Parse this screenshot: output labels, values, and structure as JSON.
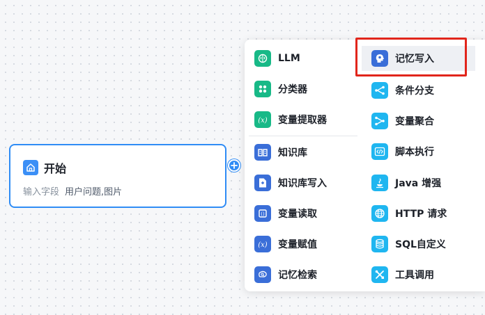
{
  "start_node": {
    "title": "开始",
    "field_label": "输入字段",
    "field_value": "用户问题,图片"
  },
  "menu": {
    "left": [
      {
        "label": "LLM",
        "icon": "brain-icon",
        "color": "#18b987"
      },
      {
        "label": "分类器",
        "icon": "grid-dots-icon",
        "color": "#18b987"
      },
      {
        "label": "变量提取器",
        "icon": "variable-x-icon",
        "color": "#18b987"
      },
      {
        "label": "知识库",
        "icon": "book-icon",
        "color": "#3a6ed8"
      },
      {
        "label": "知识库写入",
        "icon": "doc-add-icon",
        "color": "#3a6ed8"
      },
      {
        "label": "变量读取",
        "icon": "variable-read-icon",
        "color": "#3a6ed8"
      },
      {
        "label": "变量赋值",
        "icon": "variable-x-icon",
        "color": "#3a6ed8"
      },
      {
        "label": "记忆检索",
        "icon": "brain-search-icon",
        "color": "#3a6ed8"
      }
    ],
    "right": [
      {
        "label": "记忆写入",
        "icon": "head-memory-icon",
        "color": "#3a6ed8"
      },
      {
        "label": "条件分支",
        "icon": "branch-icon",
        "color": "#1fb6f0"
      },
      {
        "label": "变量聚合",
        "icon": "merge-icon",
        "color": "#1fb6f0"
      },
      {
        "label": "脚本执行",
        "icon": "code-icon",
        "color": "#1fb6f0"
      },
      {
        "label": "Java 增强",
        "icon": "java-icon",
        "color": "#1fb6f0"
      },
      {
        "label": "HTTP 请求",
        "icon": "globe-icon",
        "color": "#1fb6f0"
      },
      {
        "label": "SQL自定义",
        "icon": "database-icon",
        "color": "#1fb6f0"
      },
      {
        "label": "工具调用",
        "icon": "tools-icon",
        "color": "#1fb6f0"
      }
    ]
  },
  "colors": {
    "accent": "#2f8cf5",
    "highlight_box": "#e1251b"
  }
}
